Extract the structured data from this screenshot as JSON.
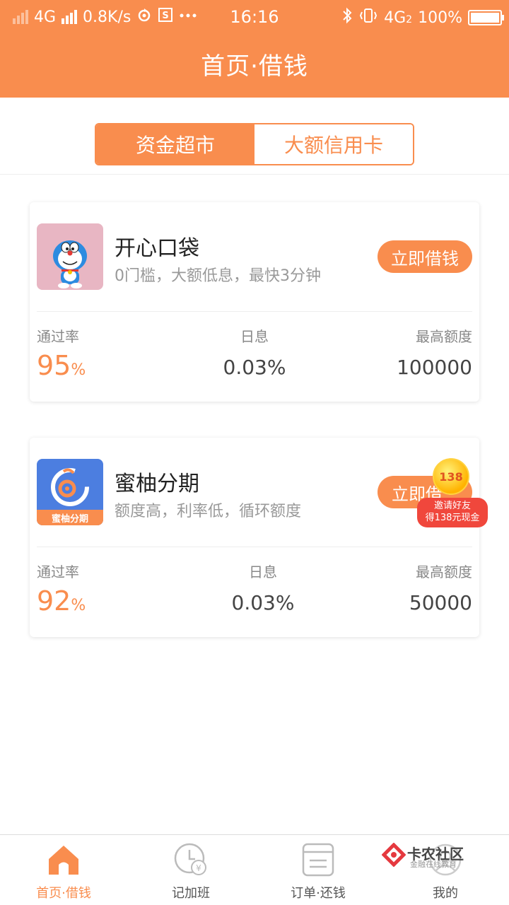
{
  "status_bar": {
    "network_left": "4G",
    "speed": "0.8K/s",
    "time": "16:16",
    "network_right": "4G",
    "network_right_sub": "2",
    "battery": "100%",
    "icons": [
      "signal-icon",
      "sync-icon",
      "s-icon",
      "more-icon",
      "bluetooth-icon",
      "vibrate-icon",
      "battery-icon"
    ]
  },
  "header": {
    "title": "首页·借钱"
  },
  "tabs": [
    {
      "label": "资金超市",
      "active": true
    },
    {
      "label": "大额信用卡",
      "active": false
    }
  ],
  "cards": [
    {
      "name": "开心口袋",
      "desc": "0门槛，大额低息，最快3分钟",
      "cta": "立即借钱",
      "logo": "doraemon-logo",
      "stats": {
        "pass_label": "通过率",
        "pass_value": "95",
        "pass_unit": "%",
        "rate_label": "日息",
        "rate_value": "0.03%",
        "limit_label": "最高额度",
        "limit_value": "100000"
      }
    },
    {
      "name": "蜜柚分期",
      "desc": "额度高，利率低，循环额度",
      "cta": "立即借",
      "logo_text": "蜜柚分期",
      "stats": {
        "pass_label": "通过率",
        "pass_value": "92",
        "pass_unit": "%",
        "rate_label": "日息",
        "rate_value": "0.03%",
        "limit_label": "最高额度",
        "limit_value": "50000"
      }
    }
  ],
  "invite_badge": {
    "number": "138",
    "line1": "邀请好友",
    "line2": "得138元现金"
  },
  "bottom_nav": [
    {
      "label": "首页·借钱",
      "icon": "home-icon",
      "active": true
    },
    {
      "label": "记加班",
      "icon": "clock-icon",
      "active": false
    },
    {
      "label": "订单·还钱",
      "icon": "order-icon",
      "active": false
    },
    {
      "label": "我的",
      "icon": "profile-icon",
      "active": false
    }
  ],
  "watermark": {
    "title": "卡农社区",
    "subtitle": "金融在线教育"
  },
  "colors": {
    "accent": "#f98d4e",
    "badge_red": "#f0473c"
  }
}
